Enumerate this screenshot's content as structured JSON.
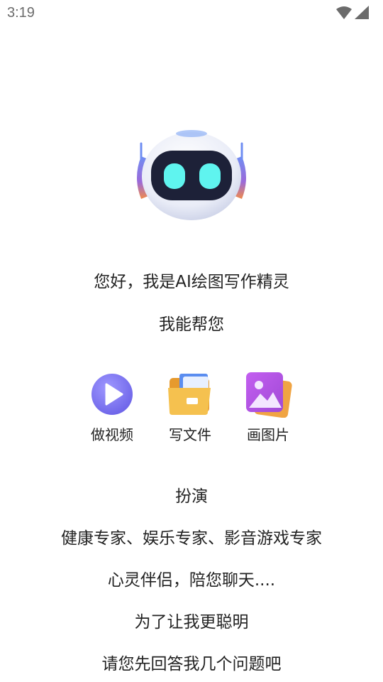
{
  "status_bar": {
    "time": "3:19",
    "icons": [
      "wifi-icon",
      "signal-icon"
    ]
  },
  "intro": {
    "greeting": "您好，我是AI绘图写作精灵",
    "can_help": "我能帮您"
  },
  "features": [
    {
      "label": "做视频",
      "icon": "play-video-icon"
    },
    {
      "label": "写文件",
      "icon": "folder-document-icon"
    },
    {
      "label": "画图片",
      "icon": "picture-gallery-icon"
    }
  ],
  "roleplay": {
    "title": "扮演",
    "roles": "健康专家、娱乐专家、影音游戏专家",
    "companion": "心灵伴侣，陪您聊天...."
  },
  "questions": {
    "reason": "为了让我更聪明",
    "prompt": "请您先回答我几个问题吧"
  },
  "colors": {
    "play_purple": "#7b74f0",
    "folder_yellow": "#f5b33d",
    "picture_purple": "#b45ae0",
    "robot_eye": "#5ff4ef"
  }
}
